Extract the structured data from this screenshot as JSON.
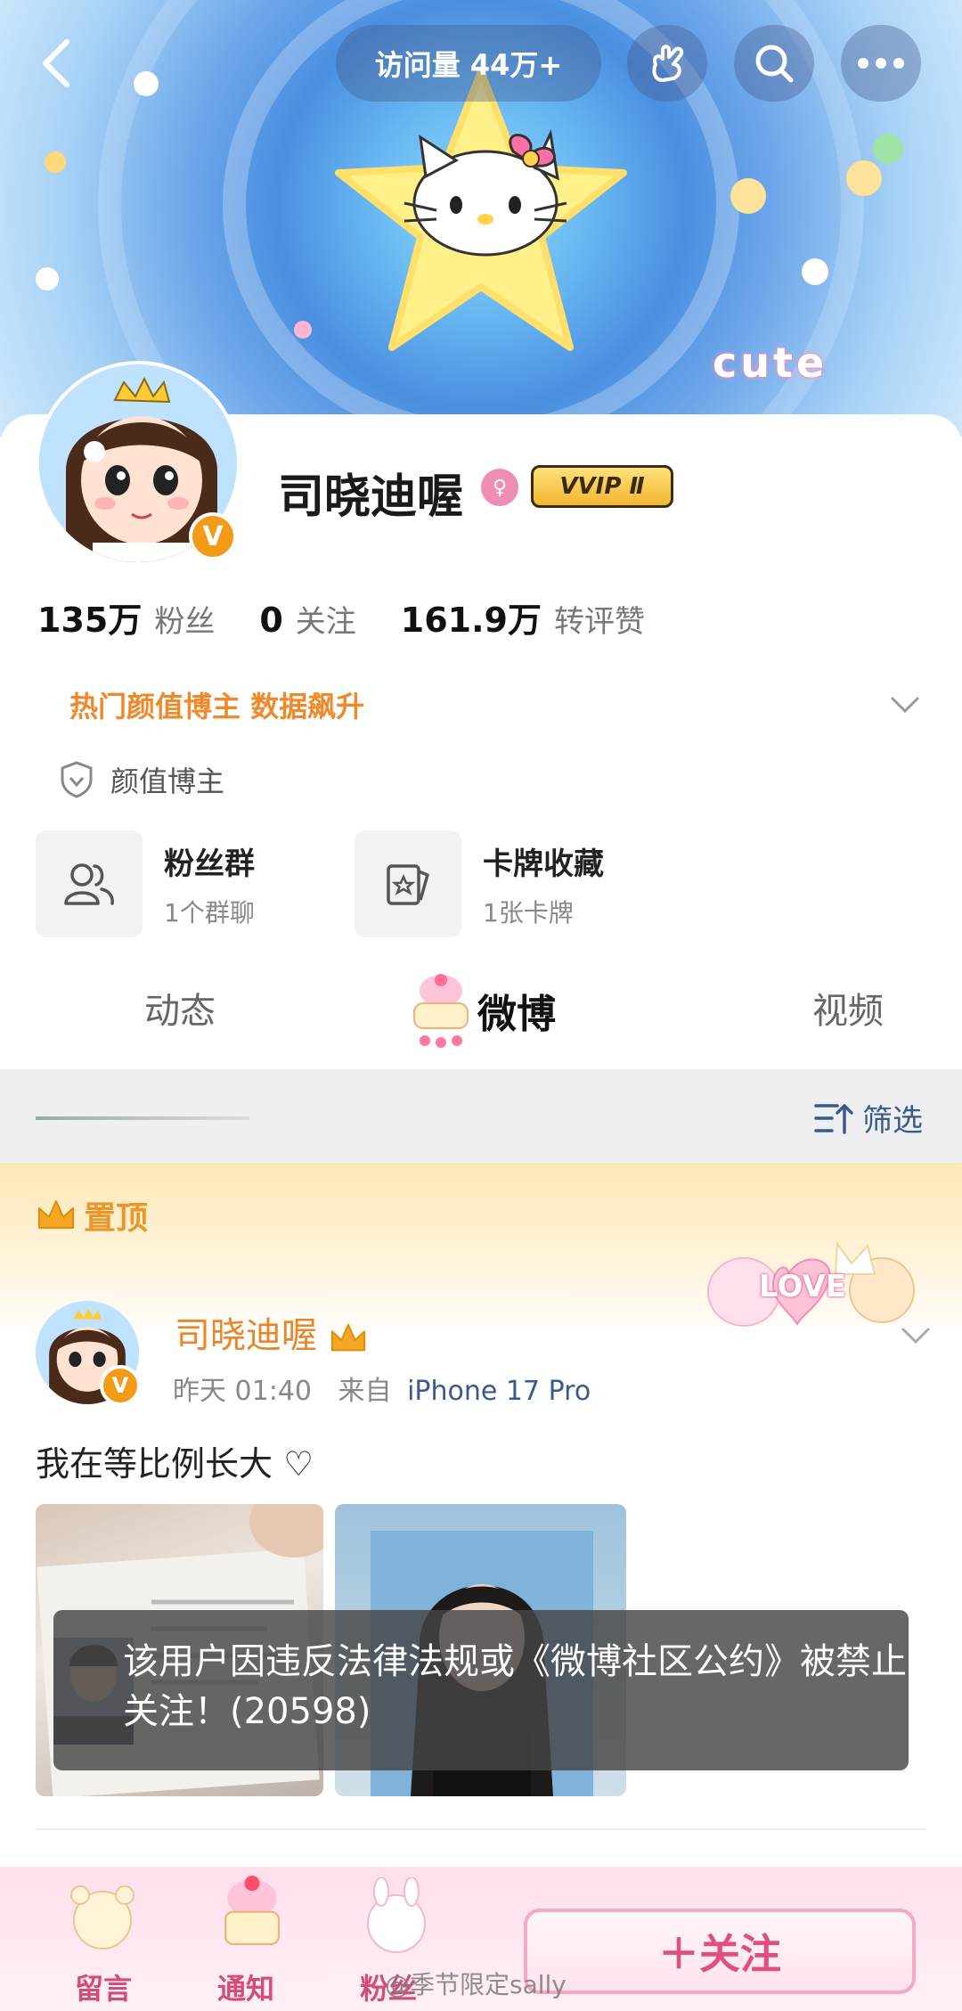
{
  "header": {
    "visits_label": "访问量 44万+",
    "banner_text": "cute"
  },
  "profile": {
    "name": "司晓迪喔",
    "vvip_label": "VVIP Ⅱ",
    "verified_mark": "V",
    "stats": [
      {
        "value": "135万",
        "label": "粉丝"
      },
      {
        "value": "0",
        "label": "关注"
      },
      {
        "value": "161.9万",
        "label": "转评赞"
      }
    ],
    "hot_tag": "热门颜值博主 数据飙升",
    "category_tag": "颜值博主",
    "features": [
      {
        "title": "粉丝群",
        "sub": "1个群聊"
      },
      {
        "title": "卡牌收藏",
        "sub": "1张卡牌"
      }
    ]
  },
  "tabs": [
    {
      "label": "动态"
    },
    {
      "label": "微博"
    },
    {
      "label": "视频"
    }
  ],
  "filter": {
    "label": "筛选"
  },
  "pinned": {
    "label": "置顶",
    "deco_text": "LOVE"
  },
  "post": {
    "author": "司晓迪喔",
    "time": "昨天 01:40",
    "source_prefix": "来自",
    "source": "iPhone 17 Pro",
    "text": "我在等比例长大 ♡",
    "ban_notice": "该用户因违反法律法规或《微博社区公约》被禁止关注！(20598)"
  },
  "bottom_bar": {
    "items": [
      "留言",
      "通知",
      "粉丝"
    ],
    "follow_label": "＋关注",
    "watermark": "@季节限定sally"
  },
  "colors": {
    "accent_orange": "#ef8a2c",
    "link_blue": "#3a5a8c",
    "follow_pink": "#e0507f"
  }
}
